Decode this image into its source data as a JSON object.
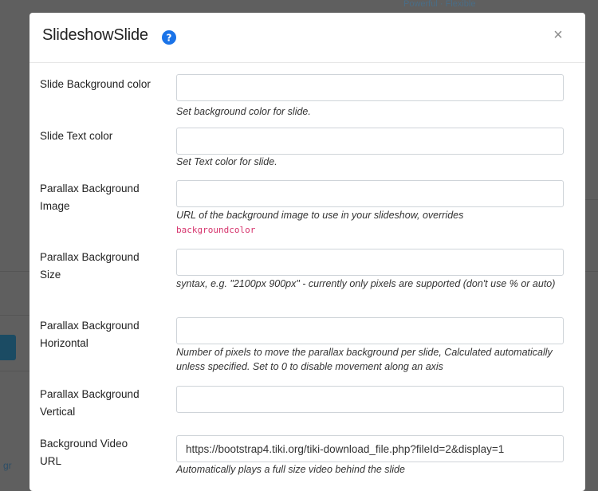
{
  "background": {
    "top_right_text": "Powerful · Flexible",
    "left_bottom_text": "gr"
  },
  "modal": {
    "title": "SlideshowSlide",
    "close_symbol": "×"
  },
  "fields": [
    {
      "label": "Slide Background color",
      "value": "",
      "help": "Set background color for slide."
    },
    {
      "label": "Slide Text color",
      "value": "",
      "help": "Set Text color for slide."
    },
    {
      "label": "Parallax Background Image",
      "value": "",
      "help": "URL of the background image to use in your slideshow, overrides",
      "help_code": "backgroundcolor"
    },
    {
      "label": "Parallax Background Size",
      "value": "",
      "help": "syntax, e.g. \"2100px 900px\" - currently only pixels are supported (don't use % or auto)"
    },
    {
      "label": "Parallax Background Horizontal",
      "value": "",
      "help": "Number of pixels to move the parallax background per slide, Calculated automatically unless specified. Set to 0 to disable movement along an axis"
    },
    {
      "label": "Parallax Background Vertical",
      "value": "",
      "help": ""
    },
    {
      "label": "Background Video URL",
      "value": "https://bootstrap4.tiki.org/tiki-download_file.php?fileId=2&display=1",
      "help": "Automatically plays a full size video behind the slide"
    }
  ],
  "colors": {
    "accent": "#1a73e8",
    "code": "#d6336c",
    "overlay": "#5f5f5f"
  }
}
